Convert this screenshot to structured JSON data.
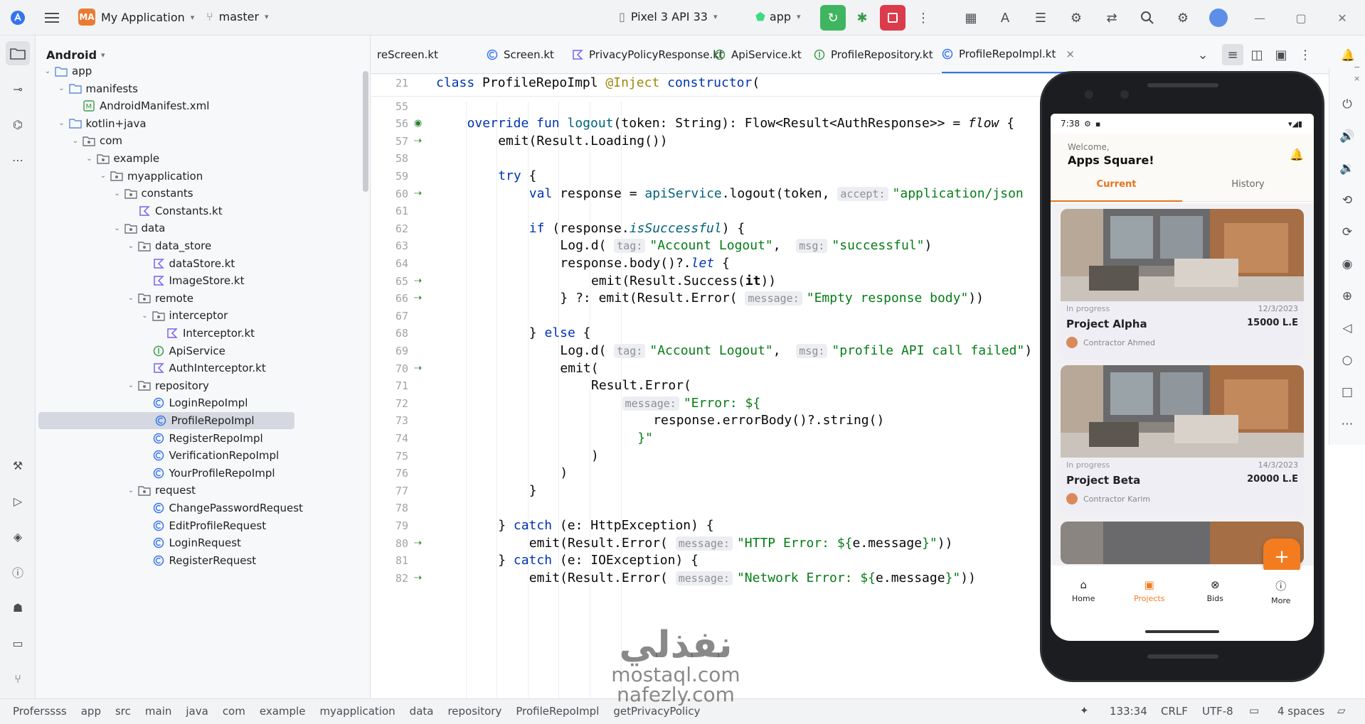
{
  "toolbar": {
    "project_badge": "MA",
    "project_name": "My Application",
    "branch": "master",
    "device": "Pixel 3 API 33",
    "run_config": "app"
  },
  "project_panel": {
    "view_mode": "Android",
    "tree": [
      {
        "label": "app",
        "indent": 0,
        "arrow": "v",
        "icon": "module"
      },
      {
        "label": "manifests",
        "indent": 1,
        "arrow": "v",
        "icon": "folder"
      },
      {
        "label": "AndroidManifest.xml",
        "indent": 2,
        "arrow": "",
        "icon": "manifest"
      },
      {
        "label": "kotlin+java",
        "indent": 1,
        "arrow": "v",
        "icon": "folder"
      },
      {
        "label": "com",
        "indent": 2,
        "arrow": "v",
        "icon": "package"
      },
      {
        "label": "example",
        "indent": 3,
        "arrow": "v",
        "icon": "package"
      },
      {
        "label": "myapplication",
        "indent": 4,
        "arrow": "v",
        "icon": "package"
      },
      {
        "label": "constants",
        "indent": 5,
        "arrow": "v",
        "icon": "package"
      },
      {
        "label": "Constants.kt",
        "indent": 6,
        "arrow": "",
        "icon": "kotlin"
      },
      {
        "label": "data",
        "indent": 5,
        "arrow": "v",
        "icon": "package"
      },
      {
        "label": "data_store",
        "indent": 6,
        "arrow": "v",
        "icon": "package"
      },
      {
        "label": "dataStore.kt",
        "indent": 7,
        "arrow": "",
        "icon": "kotlin"
      },
      {
        "label": "ImageStore.kt",
        "indent": 7,
        "arrow": "",
        "icon": "kotlin"
      },
      {
        "label": "remote",
        "indent": 6,
        "arrow": "v",
        "icon": "package"
      },
      {
        "label": "interceptor",
        "indent": 7,
        "arrow": "v",
        "icon": "package"
      },
      {
        "label": "Interceptor.kt",
        "indent": 8,
        "arrow": "",
        "icon": "kotlin"
      },
      {
        "label": "ApiService",
        "indent": 7,
        "arrow": "",
        "icon": "interface"
      },
      {
        "label": "AuthInterceptor.kt",
        "indent": 7,
        "arrow": "",
        "icon": "kotlin"
      },
      {
        "label": "repository",
        "indent": 6,
        "arrow": "v",
        "icon": "package"
      },
      {
        "label": "LoginRepoImpl",
        "indent": 7,
        "arrow": "",
        "icon": "class"
      },
      {
        "label": "ProfileRepoImpl",
        "indent": 7,
        "arrow": "",
        "icon": "class",
        "selected": true
      },
      {
        "label": "RegisterRepoImpl",
        "indent": 7,
        "arrow": "",
        "icon": "class"
      },
      {
        "label": "VerificationRepoImpl",
        "indent": 7,
        "arrow": "",
        "icon": "class"
      },
      {
        "label": "YourProfileRepoImpl",
        "indent": 7,
        "arrow": "",
        "icon": "class"
      },
      {
        "label": "request",
        "indent": 6,
        "arrow": "v",
        "icon": "package"
      },
      {
        "label": "ChangePasswordRequest",
        "indent": 7,
        "arrow": "",
        "icon": "class"
      },
      {
        "label": "EditProfileRequest",
        "indent": 7,
        "arrow": "",
        "icon": "class"
      },
      {
        "label": "LoginRequest",
        "indent": 7,
        "arrow": "",
        "icon": "class"
      },
      {
        "label": "RegisterRequest",
        "indent": 7,
        "arrow": "",
        "icon": "class"
      }
    ]
  },
  "editor_tabs": [
    {
      "label": "reScreen.kt",
      "icon": "kotlin"
    },
    {
      "label": "Screen.kt",
      "icon": "class"
    },
    {
      "label": "PrivacyPolicyResponse.kt",
      "icon": "kotlin"
    },
    {
      "label": "ApiService.kt",
      "icon": "interface"
    },
    {
      "label": "ProfileRepository.kt",
      "icon": "interface"
    },
    {
      "label": "ProfileRepoImpl.kt",
      "icon": "class",
      "active": true,
      "close": "×"
    }
  ],
  "code": {
    "lines": [
      {
        "n": "21",
        "indent": 0,
        "mark": "",
        "html": [
          [
            "kw",
            "class "
          ],
          [
            "",
            "ProfileRepoImpl "
          ],
          [
            "ann",
            "@Inject "
          ],
          [
            "kw",
            "constructor"
          ],
          [
            "",
            "("
          ]
        ]
      },
      {
        "n": "55",
        "indent": 0,
        "mark": "",
        "html": []
      },
      {
        "n": "56",
        "indent": 1,
        "mark": "override",
        "html": [
          [
            "kw",
            "override fun "
          ],
          [
            "fn",
            "logout"
          ],
          [
            "",
            "(token: String): Flow<Result<AuthResponse>> = "
          ],
          [
            "it",
            "flow"
          ],
          [
            "",
            " {"
          ]
        ]
      },
      {
        "n": "57",
        "indent": 2,
        "mark": "arrow",
        "html": [
          [
            "",
            "emit(Result.Loading())"
          ]
        ]
      },
      {
        "n": "58",
        "indent": 0,
        "mark": "",
        "html": []
      },
      {
        "n": "59",
        "indent": 2,
        "mark": "",
        "html": [
          [
            "kw",
            "try"
          ],
          [
            "",
            " {"
          ]
        ]
      },
      {
        "n": "60",
        "indent": 3,
        "mark": "arrow",
        "html": [
          [
            "kw",
            "val "
          ],
          [
            "",
            "response = "
          ],
          [
            "fn",
            "apiService"
          ],
          [
            "",
            ".logout(token, "
          ],
          [
            "hint",
            "accept:"
          ],
          [
            "str",
            "\"application/json"
          ]
        ]
      },
      {
        "n": "61",
        "indent": 0,
        "mark": "",
        "html": []
      },
      {
        "n": "62",
        "indent": 3,
        "mark": "",
        "html": [
          [
            "kw",
            "if "
          ],
          [
            "",
            "(response."
          ],
          [
            "fnit",
            "isSuccessful"
          ],
          [
            "",
            ") {"
          ]
        ]
      },
      {
        "n": "63",
        "indent": 4,
        "mark": "",
        "html": [
          [
            "",
            "Log.d( "
          ],
          [
            "hint",
            "tag:"
          ],
          [
            "str",
            "\"Account Logout\""
          ],
          [
            "",
            ",  "
          ],
          [
            "hint",
            "msg:"
          ],
          [
            "str",
            "\"successful\""
          ],
          [
            "",
            ")"
          ]
        ]
      },
      {
        "n": "64",
        "indent": 4,
        "mark": "",
        "html": [
          [
            "",
            "response.body()?."
          ],
          [
            "kwit",
            "let"
          ],
          [
            "",
            " {"
          ]
        ]
      },
      {
        "n": "65",
        "indent": 5,
        "mark": "arrow",
        "html": [
          [
            "",
            "emit(Result.Success("
          ],
          [
            "b",
            "it"
          ],
          [
            "",
            "))"
          ]
        ]
      },
      {
        "n": "66",
        "indent": 4,
        "mark": "arrow",
        "html": [
          [
            "",
            "} ?: emit(Result.Error( "
          ],
          [
            "hint",
            "message:"
          ],
          [
            "str",
            "\"Empty response body\""
          ],
          [
            "",
            "))"
          ]
        ]
      },
      {
        "n": "67",
        "indent": 0,
        "mark": "",
        "html": []
      },
      {
        "n": "68",
        "indent": 3,
        "mark": "",
        "html": [
          [
            "",
            "} "
          ],
          [
            "kw",
            "else"
          ],
          [
            "",
            " {"
          ]
        ]
      },
      {
        "n": "69",
        "indent": 4,
        "mark": "",
        "html": [
          [
            "",
            "Log.d( "
          ],
          [
            "hint",
            "tag:"
          ],
          [
            "str",
            "\"Account Logout\""
          ],
          [
            "",
            ",  "
          ],
          [
            "hint",
            "msg:"
          ],
          [
            "str",
            "\"profile API call failed\""
          ],
          [
            "",
            ")"
          ]
        ]
      },
      {
        "n": "70",
        "indent": 4,
        "mark": "arrow",
        "html": [
          [
            "",
            "emit("
          ]
        ]
      },
      {
        "n": "71",
        "indent": 5,
        "mark": "",
        "html": [
          [
            "",
            "Result.Error("
          ]
        ]
      },
      {
        "n": "72",
        "indent": 6,
        "mark": "",
        "html": [
          [
            "hint",
            "message:"
          ],
          [
            "str",
            "\"Error: ${"
          ]
        ]
      },
      {
        "n": "73",
        "indent": 7,
        "mark": "",
        "html": [
          [
            "",
            "response.errorBody()?.string()"
          ]
        ]
      },
      {
        "n": "74",
        "indent": 6,
        "mark": "",
        "html": [
          [
            "str",
            "  }\""
          ]
        ]
      },
      {
        "n": "75",
        "indent": 5,
        "mark": "",
        "html": [
          [
            "",
            ")"
          ]
        ]
      },
      {
        "n": "76",
        "indent": 4,
        "mark": "",
        "html": [
          [
            "",
            ")"
          ]
        ]
      },
      {
        "n": "77",
        "indent": 3,
        "mark": "",
        "html": [
          [
            "",
            "}"
          ]
        ]
      },
      {
        "n": "78",
        "indent": 0,
        "mark": "",
        "html": []
      },
      {
        "n": "79",
        "indent": 2,
        "mark": "",
        "html": [
          [
            "",
            "} "
          ],
          [
            "kw",
            "catch "
          ],
          [
            "",
            "(e: HttpException) {"
          ]
        ]
      },
      {
        "n": "80",
        "indent": 3,
        "mark": "arrow",
        "html": [
          [
            "",
            "emit(Result.Error( "
          ],
          [
            "hint",
            "message:"
          ],
          [
            "str",
            "\"HTTP Error: ${"
          ],
          [
            "",
            "e.message"
          ],
          [
            "str",
            "}\""
          ],
          [
            "",
            "))"
          ]
        ]
      },
      {
        "n": "81",
        "indent": 2,
        "mark": "",
        "html": [
          [
            "",
            "} "
          ],
          [
            "kw",
            "catch "
          ],
          [
            "",
            "(e: IOException) {"
          ]
        ]
      },
      {
        "n": "82",
        "indent": 3,
        "mark": "arrow",
        "html": [
          [
            "",
            "emit(Result.Error( "
          ],
          [
            "hint",
            "message:"
          ],
          [
            "str",
            "\"Network Error: ${"
          ],
          [
            "",
            "e.message"
          ],
          [
            "str",
            "}\""
          ],
          [
            "",
            "))"
          ]
        ]
      }
    ]
  },
  "phone": {
    "time": "7:38",
    "welcome": "Welcome,",
    "app_name": "Apps Square!",
    "tabs": [
      "Current",
      "History"
    ],
    "projects": [
      {
        "status": "In progress",
        "date": "12/3/2023",
        "name": "Project Alpha",
        "price": "15000 L.E",
        "contractor": "Contractor Ahmed"
      },
      {
        "status": "In progress",
        "date": "14/3/2023",
        "name": "Project Beta",
        "price": "20000 L.E",
        "contractor": "Contractor Karim"
      }
    ],
    "fab": "+",
    "nav": [
      "Home",
      "Projects",
      "Bids",
      "More"
    ],
    "accent": "#f47c20"
  },
  "statusbar": {
    "crumbs": [
      "Proferssss",
      "app",
      "src",
      "main",
      "java",
      "com",
      "example",
      "myapplication",
      "data",
      "repository",
      "ProfileRepoImpl",
      "getPrivacyPolicy"
    ],
    "position": "133:34",
    "line_sep": "CRLF",
    "encoding": "UTF-8",
    "indent": "4 spaces"
  },
  "watermark": {
    "line1": "نفذلي",
    "line2": "mostaql.com",
    "line3": "nafezly.com"
  }
}
